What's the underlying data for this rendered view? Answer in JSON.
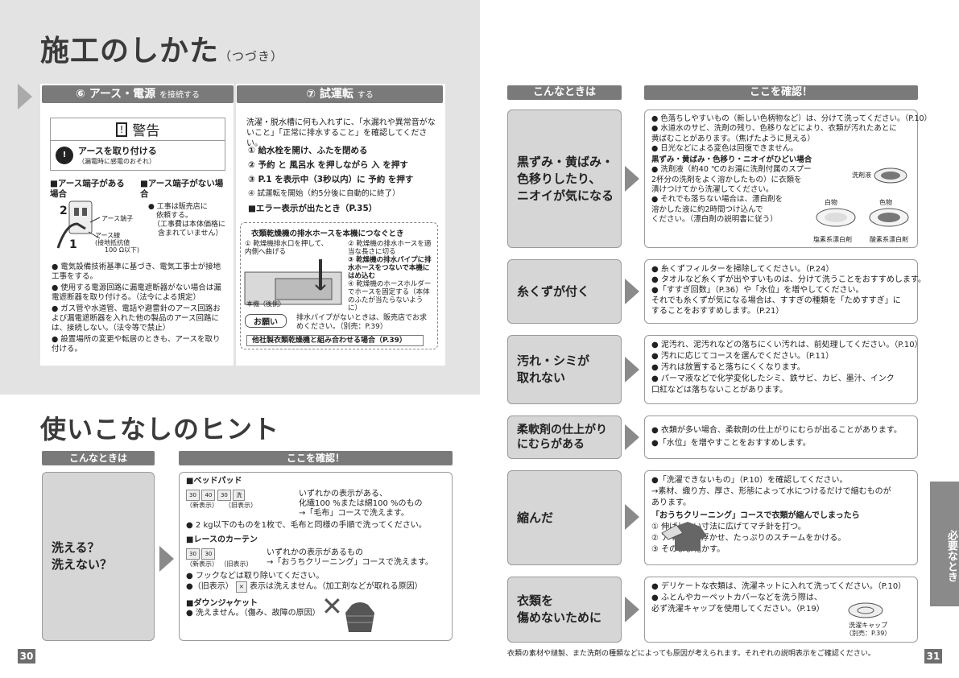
{
  "left": {
    "title": "施工のしかた",
    "title_sub": "（つづき）",
    "s6": {
      "num": "⑥",
      "label": "アース・電源",
      "suffix": "を接続する"
    },
    "s7": {
      "num": "⑦",
      "label": "試運転",
      "suffix": "する"
    },
    "warning": {
      "label": "警告",
      "item": "アースを取り付ける",
      "item_sub": "（漏電時に感電のおそれ）"
    },
    "earth": {
      "a_head": "■アース端子がある場合",
      "b_head": "■アース端子がない場合",
      "b_note": [
        "● 工事は販売店に",
        "依頼する。",
        "（工事費は本体価格に",
        "含まれていません）"
      ],
      "n2": "2",
      "n1": "1",
      "lbl_terminal": "アース端子",
      "lbl_wire": "アース線",
      "lbl_wire2": "(接地抵抗値",
      "lbl_wire3": "100 Ω以下)"
    },
    "earth_list": [
      "● 電気設備技術基準に基づき、電気工事士が接地工事をする。",
      "● 使用する電源回路に漏電遮断器がない場合は漏電遮断器を取り付ける。（法令による規定）",
      "● ガス管や水道管、電話や避雷針のアース回路および漏電遮断器を入れた他の製品のアース回路には、接続しない。（法令等で禁止）",
      "● 設置場所の変更や転居のときも、アースを取り付ける。"
    ],
    "test_intro": "洗濯・脱水槽に何も入れずに、「水漏れや異常音がないこと」「正常に排水すること」を確認してください。",
    "test_steps": [
      "① 給水栓を開け、ふたを閉める",
      "② 予約 と 風呂水 を押しながら 入 を押す",
      "③ P.1 を表示中（3秒以内）に 予約 を押す",
      "④ 試運転を開始（約5分後に自動的に終了）",
      "■エラー表示が出たとき（P.35）"
    ],
    "dryer": {
      "title": "衣類乾燥機の排水ホースを本機につなぐとき",
      "c1": "① 乾燥機排水口を押して、内側へ曲げる",
      "c2": "② 乾燥機の排水ホースを適当な長さに切る",
      "c3": "③ 乾燥機の排水パイプに排水ホースをつないで本機にはめ込む",
      "c4": "④ 乾燥機のホースホルダーでホースを固定する（本体のふたが当たらないように）",
      "label_body": "本機（後側）",
      "request": "お願い",
      "request_text": "排水パイプがないときは、販売店でお求めください。（別売：P.39）",
      "footer": "他社製衣類乾燥機と組み合わせる場合（P.39）"
    },
    "hint_title": "使いこなしのヒント",
    "hint": {
      "col1": "こんなときは",
      "col2": "ここを確認！",
      "row": "洗える？\n洗えない？",
      "bed_title": "■ベッドパッド",
      "bed_new": "（新表示）",
      "bed_old": "（旧表示）",
      "bed_text1": "いずれかの表示がある、",
      "bed_text2": "化繊100 %または綿100 %のもの",
      "bed_text3": "→「毛布」コースで洗えます。",
      "bed_note": "● 2 kg以下のものを1枚で、毛布と同様の手順で洗ってください。",
      "lace_title": "■レースのカーテン",
      "lace_new": "（新表示）",
      "lace_old": "（旧表示）",
      "lace_text1": "いずれかの表示があるもの",
      "lace_text2": "→「おうちクリーニング」コースで洗えます。",
      "lace_note1": "● フックなどは取り除いてください。",
      "lace_note2": "●（旧表示）",
      "lace_note2b": "表示は洗えません。（加工剤などが取れる原因）",
      "down_title": "■ダウンジャケット",
      "down_note": "● 洗えません。（傷み、故障の原因）"
    },
    "page": "30"
  },
  "right": {
    "col1": "こんなときは",
    "col2": "ここを確認！",
    "rows": [
      {
        "q": "黒ずみ・黄ばみ・\n色移りしたり、\nニオイが気になる",
        "lines": [
          "● 色落ちしやすいもの（新しい色柄物など）は、分けて洗ってください。（P.10）",
          "● 水道水のサビ、洗剤の残り、色移りなどにより、衣類が汚れたあとに",
          "  黄ばむことがあります。（焦げたように見える）",
          "● 日光などによる変色は回復できません。",
          "黒ずみ・黄ばみ・色移り・ニオイがひどい場合",
          "● 洗剤液（約40 ℃のお湯に洗剤付属のスプーン",
          "  2杯分の洗剤をよく溶かしたもの）に衣類を",
          "  漬けつけてから洗濯してください。",
          "● それでも落ちない場合は、漂白剤を",
          "  溶かした液に約2時間つけ込んで",
          "  ください。（漂白剤の説明書に従う）"
        ],
        "fig": {
          "a": "洗剤液",
          "b": "白物",
          "c": "色物",
          "d": "塩素系漂白剤",
          "e": "酸素系漂白剤"
        }
      },
      {
        "q": "糸くずが付く",
        "lines": [
          "● 糸くずフィルターを掃除してください。（P.24）",
          "● タオルなど糸くずが出やすいものは、分けて洗うことをおすすめします。",
          "●「すすぎ回数」（P.36）や「水位」を増やしてください。",
          "  それでも糸くずが気になる場合は、すすぎの種類を「ためすすぎ」に",
          "  することをおすすめします。（P.21）"
        ]
      },
      {
        "q": "汚れ・シミが\n取れない",
        "lines": [
          "● 泥汚れ、泥汚れなどの落ちにくい汚れは、前処理してください。（P.10）",
          "● 汚れに応じてコースを選んでください。（P.11）",
          "● 汚れは放置すると落ちにくくなります。",
          "● パーマ液などで化学変化したシミ、鉄サビ、カビ、墨汁、インク",
          "  口紅などは落ちないことがあります。"
        ]
      },
      {
        "q": "柔軟剤の仕上がり\nにむらがある",
        "lines": [
          "● 衣類が多い場合、柔軟剤の仕上がりにむらが出ることがあります。",
          "●「水位」を増やすことをおすすめします。"
        ]
      },
      {
        "q": "縮んだ",
        "lines": [
          "●「洗濯できないもの」（P.10）を確認してください。",
          "  →素材、織り方、厚さ、形態によって水につけるだけで縮むものが",
          "  あります。",
          "「おうちクリーニング」コースで衣類が縮んでしまったら",
          "           ① 伸ばしたい寸法に広げてマチ針を打つ。",
          "           ② アイロンを浮かせ、たっぷりのスチームをかける。",
          "           ③ そのまま乾かす。"
        ]
      },
      {
        "q": "衣類を\n傷めないために",
        "lines": [
          "● デリケートな衣類は、洗濯ネットに入れて洗ってください。（P.10）",
          "● ふとんやカーペットカバーなどを洗う際は、",
          "  必ず洗濯キャップを使用してください。（P.19）"
        ],
        "cap": "洗濯キャップ",
        "cap2": "（別売：P.39）"
      }
    ],
    "caption": "衣類の素材や縫製、また洗剤の種類などによっても原因が考えられます。それぞれの説明表示をご確認ください。",
    "tab": "必要なとき",
    "page": "31"
  }
}
